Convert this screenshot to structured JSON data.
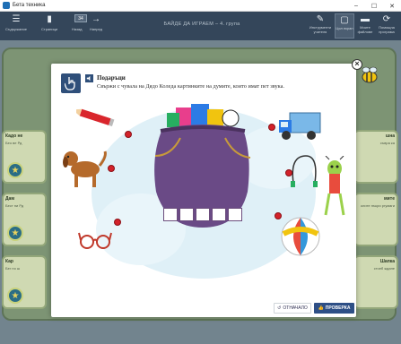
{
  "window": {
    "title": "Бета техника",
    "controls": [
      "–",
      "☐",
      "✕"
    ]
  },
  "toolbar": {
    "items": [
      {
        "icon": "menu-icon",
        "label": "Съдържание"
      },
      {
        "icon": "book-icon",
        "label": "Страници"
      },
      {
        "icon": "arrow-left-icon",
        "label": "Назад"
      },
      {
        "icon": "page-number",
        "label": "",
        "value": "34"
      },
      {
        "icon": "arrow-right-icon",
        "label": "Напред"
      }
    ],
    "center_title": "БАЙДЕ ДА ИГРАЕМ – 4. група",
    "right_items": [
      {
        "icon": "tools-icon",
        "label": "Инструменти учителя"
      },
      {
        "icon": "screen-icon",
        "label": "Цял екран"
      },
      {
        "icon": "folder-icon",
        "label": "Моите файлове"
      },
      {
        "icon": "refresh-icon",
        "label": "Помощна програма"
      }
    ]
  },
  "background_cards": [
    {
      "label": "Кадо не",
      "text": "Бео ве Рд"
    },
    {
      "label": "Дам",
      "text": "Бест ни Рд"
    },
    {
      "label": "Кар",
      "text": "Бег по ш"
    },
    {
      "label": "шна",
      "text": "съвра ка"
    },
    {
      "label": "мите",
      "text": "олите пъкри ргумаги"
    },
    {
      "label": "Шапка",
      "text": "стоеб ждане"
    }
  ],
  "modal": {
    "title": "Подаръци",
    "instruction": "Свържи с чувала на Дядо Коледа картинките на думите, които имат пет звука.",
    "letter_slots": 5,
    "pictures": [
      "pencil",
      "dog",
      "glasses",
      "truck",
      "jump-rope",
      "grasshopper",
      "ball",
      "santa-sack"
    ],
    "buttons": {
      "reset": "ОТНАЧАЛО",
      "check": "ПРОВЕРКА"
    }
  },
  "colors": {
    "toolbar": "#34465a",
    "modal_primary": "#2e4f86",
    "dot": "#d3222a",
    "sack": "#6a4a86"
  }
}
